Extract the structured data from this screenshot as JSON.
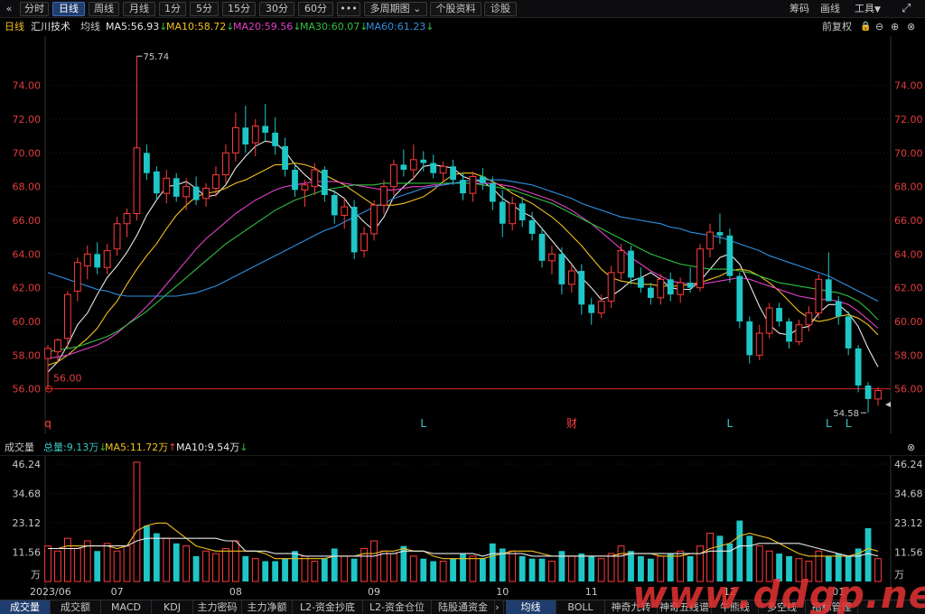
{
  "toolbar": {
    "back_icon": "«",
    "tabs": [
      "分时",
      "日线",
      "周线",
      "月线",
      "1分",
      "5分",
      "15分",
      "30分",
      "60分"
    ],
    "active_tab": 1,
    "more_icon": "•••",
    "multi_period": "多周期图",
    "stock_info": "个股资料",
    "diagnose": "诊股",
    "chip": "筹码",
    "draw": "画线",
    "tools": "工具",
    "expand_icon": "⤢"
  },
  "ma_bar": {
    "period": "日线",
    "stock_name": "汇川技术",
    "avg_line": "均线",
    "items": [
      {
        "label": "MA5:56.93",
        "color": "#e8e8e8",
        "arrow": "↓"
      },
      {
        "label": "MA10:58.72",
        "color": "#f0c020",
        "arrow": "↓"
      },
      {
        "label": "MA20:59.56",
        "color": "#e040c8",
        "arrow": "↓"
      },
      {
        "label": "MA30:60.07",
        "color": "#30c040",
        "arrow": "↓"
      },
      {
        "label": "MA60:61.23",
        "color": "#2f8fe0",
        "arrow": "↓"
      }
    ],
    "adjust": "前复权"
  },
  "chart_data": {
    "type": "candlestick",
    "y_ticks": [
      "74.00",
      "72.00",
      "70.00",
      "68.00",
      "66.00",
      "64.00",
      "62.00",
      "60.00",
      "58.00",
      "56.00"
    ],
    "ylim": [
      54.0,
      76.5
    ],
    "high_label": "75.74",
    "low_label": "54.58",
    "ref_line": "56.00",
    "ref_value": 56.0,
    "event_markers": [
      {
        "text": "q",
        "color": "#ff4040",
        "bar": 0
      },
      {
        "text": "L",
        "color": "#3cc8c8",
        "bar": 38
      },
      {
        "text": "财",
        "color": "#ff4040",
        "bar": 53
      },
      {
        "text": "L",
        "color": "#3cc8c8",
        "bar": 69
      },
      {
        "text": "L",
        "color": "#3cc8c8",
        "bar": 79
      },
      {
        "text": "L",
        "color": "#3cc8c8",
        "bar": 81
      }
    ],
    "x_labels": [
      {
        "text": "2023/06",
        "bar": 0
      },
      {
        "text": "07",
        "bar": 7
      },
      {
        "text": "08",
        "bar": 19
      },
      {
        "text": "09",
        "bar": 33
      },
      {
        "text": "10",
        "bar": 46
      },
      {
        "text": "11",
        "bar": 55
      },
      {
        "text": "12",
        "bar": 69
      },
      {
        "text": "01",
        "bar": 80
      }
    ],
    "candles": [
      [
        57.8,
        58.6,
        56.0,
        58.4
      ],
      [
        58.2,
        59.0,
        57.6,
        58.9
      ],
      [
        59.0,
        61.8,
        58.4,
        61.6
      ],
      [
        61.8,
        63.8,
        61.2,
        63.5
      ],
      [
        63.3,
        64.5,
        62.5,
        64.0
      ],
      [
        64.0,
        64.7,
        62.8,
        63.2
      ],
      [
        63.2,
        64.6,
        62.8,
        64.2
      ],
      [
        64.3,
        66.2,
        63.9,
        65.8
      ],
      [
        65.8,
        66.7,
        65.0,
        66.4
      ],
      [
        66.4,
        75.74,
        66.0,
        70.3
      ],
      [
        70.0,
        70.5,
        68.4,
        68.8
      ],
      [
        68.9,
        69.2,
        67.2,
        67.6
      ],
      [
        67.6,
        69.0,
        67.0,
        68.5
      ],
      [
        68.5,
        68.8,
        67.1,
        67.4
      ],
      [
        67.4,
        68.5,
        66.6,
        68.0
      ],
      [
        68.0,
        68.6,
        66.9,
        67.2
      ],
      [
        67.3,
        68.2,
        66.8,
        67.9
      ],
      [
        67.9,
        69.2,
        67.4,
        68.7
      ],
      [
        68.7,
        70.5,
        68.2,
        70.0
      ],
      [
        70.0,
        72.4,
        69.5,
        71.5
      ],
      [
        71.5,
        72.8,
        70.0,
        70.5
      ],
      [
        70.6,
        72.0,
        69.8,
        71.6
      ],
      [
        71.6,
        72.9,
        70.7,
        71.2
      ],
      [
        71.2,
        72.1,
        69.9,
        70.4
      ],
      [
        70.4,
        70.9,
        68.6,
        69.0
      ],
      [
        69.0,
        69.3,
        67.4,
        67.8
      ],
      [
        67.8,
        68.4,
        66.8,
        68.1
      ],
      [
        68.0,
        69.4,
        67.5,
        69.0
      ],
      [
        69.0,
        69.2,
        67.1,
        67.5
      ],
      [
        67.5,
        67.8,
        65.8,
        66.3
      ],
      [
        66.3,
        67.3,
        65.5,
        66.8
      ],
      [
        66.8,
        67.2,
        63.7,
        64.1
      ],
      [
        64.2,
        65.6,
        63.8,
        65.2
      ],
      [
        65.2,
        67.2,
        64.8,
        66.9
      ],
      [
        66.9,
        68.4,
        66.4,
        68.0
      ],
      [
        68.0,
        69.6,
        67.5,
        69.3
      ],
      [
        69.3,
        70.2,
        68.6,
        69.0
      ],
      [
        69.0,
        70.5,
        68.4,
        69.6
      ],
      [
        69.6,
        70.1,
        68.9,
        69.4
      ],
      [
        69.4,
        69.9,
        68.5,
        68.8
      ],
      [
        68.8,
        69.5,
        68.3,
        69.2
      ],
      [
        69.2,
        69.6,
        68.1,
        68.4
      ],
      [
        68.4,
        68.8,
        67.2,
        67.6
      ],
      [
        67.6,
        68.9,
        67.1,
        68.6
      ],
      [
        68.6,
        69.1,
        67.8,
        68.2
      ],
      [
        68.2,
        68.6,
        66.6,
        67.1
      ],
      [
        67.1,
        67.8,
        65.0,
        65.8
      ],
      [
        65.8,
        67.4,
        65.4,
        67.0
      ],
      [
        67.0,
        67.4,
        65.6,
        66.0
      ],
      [
        66.0,
        66.5,
        64.8,
        65.2
      ],
      [
        65.2,
        65.6,
        63.2,
        63.6
      ],
      [
        63.6,
        64.5,
        62.8,
        64.0
      ],
      [
        64.0,
        64.4,
        61.6,
        62.2
      ],
      [
        62.2,
        63.4,
        61.7,
        63.0
      ],
      [
        63.0,
        63.4,
        60.4,
        61.0
      ],
      [
        61.0,
        61.4,
        59.8,
        60.5
      ],
      [
        60.5,
        61.6,
        60.2,
        61.2
      ],
      [
        61.2,
        63.3,
        60.8,
        62.9
      ],
      [
        62.9,
        64.6,
        62.5,
        64.2
      ],
      [
        64.2,
        64.5,
        62.2,
        62.6
      ],
      [
        62.6,
        63.2,
        61.7,
        62.0
      ],
      [
        62.0,
        62.3,
        61.0,
        61.4
      ],
      [
        61.4,
        62.8,
        61.0,
        62.5
      ],
      [
        62.5,
        62.9,
        61.2,
        61.6
      ],
      [
        61.6,
        62.6,
        61.1,
        62.3
      ],
      [
        62.3,
        63.2,
        61.7,
        62.0
      ],
      [
        62.0,
        64.6,
        61.8,
        64.3
      ],
      [
        64.3,
        65.8,
        63.8,
        65.3
      ],
      [
        65.3,
        66.4,
        64.6,
        65.1
      ],
      [
        65.1,
        65.5,
        62.3,
        62.7
      ],
      [
        62.7,
        62.9,
        59.6,
        60.0
      ],
      [
        60.0,
        60.3,
        57.5,
        58.0
      ],
      [
        58.0,
        59.8,
        57.7,
        59.3
      ],
      [
        59.3,
        61.1,
        59.0,
        60.8
      ],
      [
        60.8,
        61.1,
        59.7,
        60.0
      ],
      [
        60.0,
        60.2,
        58.4,
        58.8
      ],
      [
        58.8,
        60.1,
        58.6,
        59.8
      ],
      [
        59.8,
        60.9,
        59.4,
        60.5
      ],
      [
        60.5,
        62.8,
        60.2,
        62.5
      ],
      [
        62.5,
        64.1,
        61.8,
        61.2
      ],
      [
        61.2,
        61.5,
        59.8,
        60.3
      ],
      [
        60.3,
        60.6,
        58.0,
        58.4
      ],
      [
        58.4,
        58.6,
        55.8,
        56.2
      ],
      [
        56.2,
        56.4,
        54.58,
        55.4
      ],
      [
        55.4,
        56.1,
        55.0,
        55.9
      ]
    ],
    "ma": {
      "MA5": {
        "color": "#e8e8e8",
        "values": [
          57.0,
          57.6,
          58.6,
          59.8,
          60.5,
          61.6,
          62.6,
          63.3,
          64.1,
          65.1,
          66.3,
          67.2,
          68.0,
          68.1,
          68.3,
          67.9,
          67.4,
          67.5,
          68.1,
          69.1,
          69.8,
          70.4,
          70.7,
          70.6,
          70.1,
          69.3,
          68.7,
          68.2,
          67.9,
          67.7,
          67.3,
          66.5,
          65.9,
          65.4,
          66.2,
          67.4,
          68.0,
          68.5,
          69.2,
          69.3,
          69.2,
          69.1,
          68.6,
          68.4,
          68.3,
          67.9,
          67.3,
          66.9,
          66.5,
          66.2,
          65.5,
          64.8,
          64.1,
          63.4,
          62.6,
          62.0,
          61.3,
          61.5,
          61.9,
          62.4,
          62.6,
          62.9,
          62.5,
          62.0,
          61.9,
          61.9,
          62.4,
          63.1,
          63.8,
          64.0,
          63.4,
          62.2,
          60.9,
          59.8,
          59.3,
          59.2,
          59.6,
          59.7,
          60.5,
          61.0,
          61.0,
          60.5,
          59.7,
          58.4,
          57.3
        ]
      },
      "MA10": {
        "color": "#f0c020",
        "values": [
          57.4,
          57.6,
          58.0,
          58.5,
          59.0,
          59.6,
          60.5,
          61.2,
          62.2,
          63.1,
          63.9,
          64.6,
          65.5,
          66.3,
          66.9,
          67.4,
          67.6,
          67.7,
          67.9,
          68.2,
          68.4,
          68.7,
          69.0,
          69.3,
          69.3,
          69.4,
          69.3,
          69.1,
          68.7,
          68.4,
          68.1,
          67.7,
          67.3,
          66.9,
          66.9,
          66.9,
          67.0,
          67.2,
          67.4,
          67.8,
          68.3,
          68.7,
          68.8,
          68.8,
          68.6,
          68.3,
          68.0,
          67.6,
          67.3,
          67.0,
          66.6,
          66.2,
          65.7,
          65.1,
          64.5,
          63.8,
          63.1,
          62.6,
          62.4,
          62.3,
          62.2,
          62.2,
          62.1,
          62.1,
          62.1,
          62.2,
          62.3,
          62.5,
          62.7,
          63.0,
          63.1,
          63.0,
          62.7,
          62.3,
          61.8,
          61.2,
          60.6,
          60.2,
          60.0,
          60.1,
          60.3,
          60.4,
          60.2,
          59.8,
          59.2
        ]
      },
      "MA20": {
        "color": "#e040c8",
        "values": [
          57.8,
          57.9,
          58.0,
          58.2,
          58.4,
          58.6,
          58.9,
          59.3,
          59.8,
          60.3,
          60.9,
          61.5,
          62.2,
          62.9,
          63.6,
          64.3,
          64.9,
          65.4,
          65.9,
          66.4,
          66.8,
          67.2,
          67.5,
          67.8,
          68.0,
          68.1,
          68.2,
          68.3,
          68.3,
          68.3,
          68.2,
          68.1,
          68.0,
          67.9,
          67.8,
          67.8,
          67.9,
          68.0,
          68.0,
          68.1,
          68.1,
          68.2,
          68.2,
          68.2,
          68.2,
          68.2,
          68.1,
          68.0,
          67.8,
          67.6,
          67.4,
          67.2,
          66.9,
          66.6,
          66.2,
          65.8,
          65.3,
          64.8,
          64.3,
          63.8,
          63.4,
          63.0,
          62.7,
          62.4,
          62.3,
          62.2,
          62.2,
          62.3,
          62.4,
          62.5,
          62.6,
          62.5,
          62.3,
          62.1,
          61.9,
          61.7,
          61.5,
          61.4,
          61.3,
          61.3,
          61.2,
          61.0,
          60.6,
          60.1,
          59.6
        ]
      },
      "MA30": {
        "color": "#30c040",
        "values": [
          58.2,
          58.3,
          58.4,
          58.5,
          58.7,
          58.9,
          59.1,
          59.4,
          59.8,
          60.2,
          60.6,
          61.1,
          61.6,
          62.1,
          62.6,
          63.1,
          63.6,
          64.1,
          64.6,
          65.0,
          65.4,
          65.8,
          66.2,
          66.6,
          66.9,
          67.2,
          67.4,
          67.6,
          67.8,
          67.9,
          68.0,
          68.1,
          68.1,
          68.1,
          68.2,
          68.2,
          68.2,
          68.2,
          68.2,
          68.2,
          68.2,
          68.2,
          68.2,
          68.2,
          68.1,
          68.0,
          67.9,
          67.8,
          67.6,
          67.4,
          67.2,
          67.0,
          66.7,
          66.4,
          66.1,
          65.8,
          65.5,
          65.2,
          64.9,
          64.6,
          64.3,
          64.0,
          63.8,
          63.6,
          63.4,
          63.3,
          63.2,
          63.1,
          63.1,
          63.1,
          63.0,
          62.9,
          62.7,
          62.5,
          62.3,
          62.2,
          62.1,
          62.0,
          61.9,
          61.8,
          61.7,
          61.5,
          61.2,
          60.7,
          60.1
        ]
      },
      "MA60": {
        "color": "#2f8fe0",
        "values": [
          62.9,
          62.7,
          62.5,
          62.3,
          62.1,
          61.9,
          61.8,
          61.6,
          61.5,
          61.5,
          61.5,
          61.5,
          61.5,
          61.5,
          61.6,
          61.7,
          61.9,
          62.1,
          62.4,
          62.7,
          63.0,
          63.3,
          63.6,
          63.9,
          64.2,
          64.5,
          64.8,
          65.1,
          65.4,
          65.6,
          65.9,
          66.2,
          66.5,
          66.8,
          67.0,
          67.3,
          67.5,
          67.7,
          67.9,
          68.0,
          68.1,
          68.2,
          68.3,
          68.4,
          68.4,
          68.4,
          68.4,
          68.3,
          68.2,
          68.1,
          67.9,
          67.7,
          67.5,
          67.3,
          67.0,
          66.8,
          66.6,
          66.4,
          66.2,
          66.1,
          66.0,
          65.9,
          65.8,
          65.6,
          65.5,
          65.3,
          65.2,
          65.1,
          65.0,
          64.8,
          64.6,
          64.4,
          64.2,
          63.9,
          63.7,
          63.5,
          63.3,
          63.1,
          62.9,
          62.7,
          62.4,
          62.1,
          61.8,
          61.5,
          61.2
        ]
      }
    }
  },
  "volume": {
    "title": "成交量",
    "total_label": "总量:9.13万",
    "total_arrow": "↓",
    "ma5_label": "MA5:11.72万",
    "ma5_arrow": "↑",
    "ma10_label": "MA10:9.54万",
    "ma10_arrow": "↓",
    "unit": "万",
    "y_ticks": [
      "46.24",
      "34.68",
      "23.12",
      "11.56"
    ],
    "ylim": [
      0,
      46.24
    ],
    "values": [
      14,
      12,
      17,
      13,
      16,
      12,
      15,
      12,
      14,
      47,
      22,
      19,
      17,
      15,
      14,
      10,
      12,
      11,
      13,
      16,
      10,
      9,
      8,
      8,
      9,
      12,
      10,
      8,
      9,
      13,
      10,
      9,
      13,
      16,
      12,
      11,
      14,
      10,
      9,
      8,
      8,
      9,
      11,
      10,
      9,
      15,
      13,
      12,
      10,
      9,
      9,
      8,
      12,
      10,
      11,
      10,
      9,
      11,
      14,
      12,
      10,
      9,
      10,
      11,
      12,
      10,
      14,
      19,
      18,
      15,
      24,
      18,
      14,
      12,
      11,
      10,
      9,
      8,
      12,
      10,
      11,
      10,
      13,
      21,
      9
    ],
    "ma5": [
      13,
      13,
      14,
      14,
      14,
      14,
      14,
      13,
      14,
      20,
      22,
      23,
      23,
      20,
      17,
      14,
      13,
      12,
      12,
      12,
      12,
      12,
      11,
      9,
      9,
      9,
      9,
      9,
      9,
      10,
      10,
      10,
      11,
      11,
      12,
      12,
      13,
      12,
      12,
      10,
      9,
      9,
      9,
      9,
      9,
      10,
      11,
      12,
      12,
      12,
      11,
      10,
      10,
      10,
      10,
      10,
      10,
      10,
      11,
      11,
      11,
      11,
      10,
      10,
      10,
      11,
      11,
      13,
      14,
      15,
      18,
      19,
      18,
      17,
      15,
      13,
      11,
      10,
      10,
      10,
      10,
      10,
      11,
      13,
      12
    ],
    "ma10": [
      13,
      13,
      13,
      13,
      14,
      14,
      14,
      14,
      14,
      16,
      17,
      17,
      17,
      17,
      17,
      17,
      17,
      17,
      16,
      16,
      12,
      12,
      12,
      11,
      11,
      11,
      10,
      10,
      10,
      10,
      10,
      10,
      10,
      10,
      11,
      11,
      12,
      12,
      12,
      11,
      11,
      11,
      11,
      11,
      10,
      11,
      11,
      11,
      11,
      10,
      10,
      10,
      10,
      10,
      10,
      10,
      10,
      10,
      10,
      11,
      11,
      11,
      11,
      11,
      11,
      11,
      11,
      12,
      12,
      12,
      14,
      14,
      15,
      15,
      15,
      15,
      15,
      14,
      13,
      12,
      11,
      10,
      10,
      11,
      10
    ]
  },
  "bottom_tabs_left": [
    "成交量",
    "成交额",
    "MACD",
    "KDJ",
    "主力密码",
    "主力净额",
    "L2-资金抄底",
    "L2-资金仓位",
    "陆股通资金"
  ],
  "bottom_tabs_right": [
    "均线",
    "BOLL",
    "神奇九转",
    "神奇五线谱",
    "牛熊线",
    "多空线",
    "指标管理"
  ],
  "watermark": "www.ddgp.net",
  "colors": {
    "up": "#ff3b3b",
    "down": "#1fc6c6",
    "bg": "#000000",
    "grid": "#1c1c1c",
    "axis": "#e23c3c",
    "ref": "#d22"
  }
}
